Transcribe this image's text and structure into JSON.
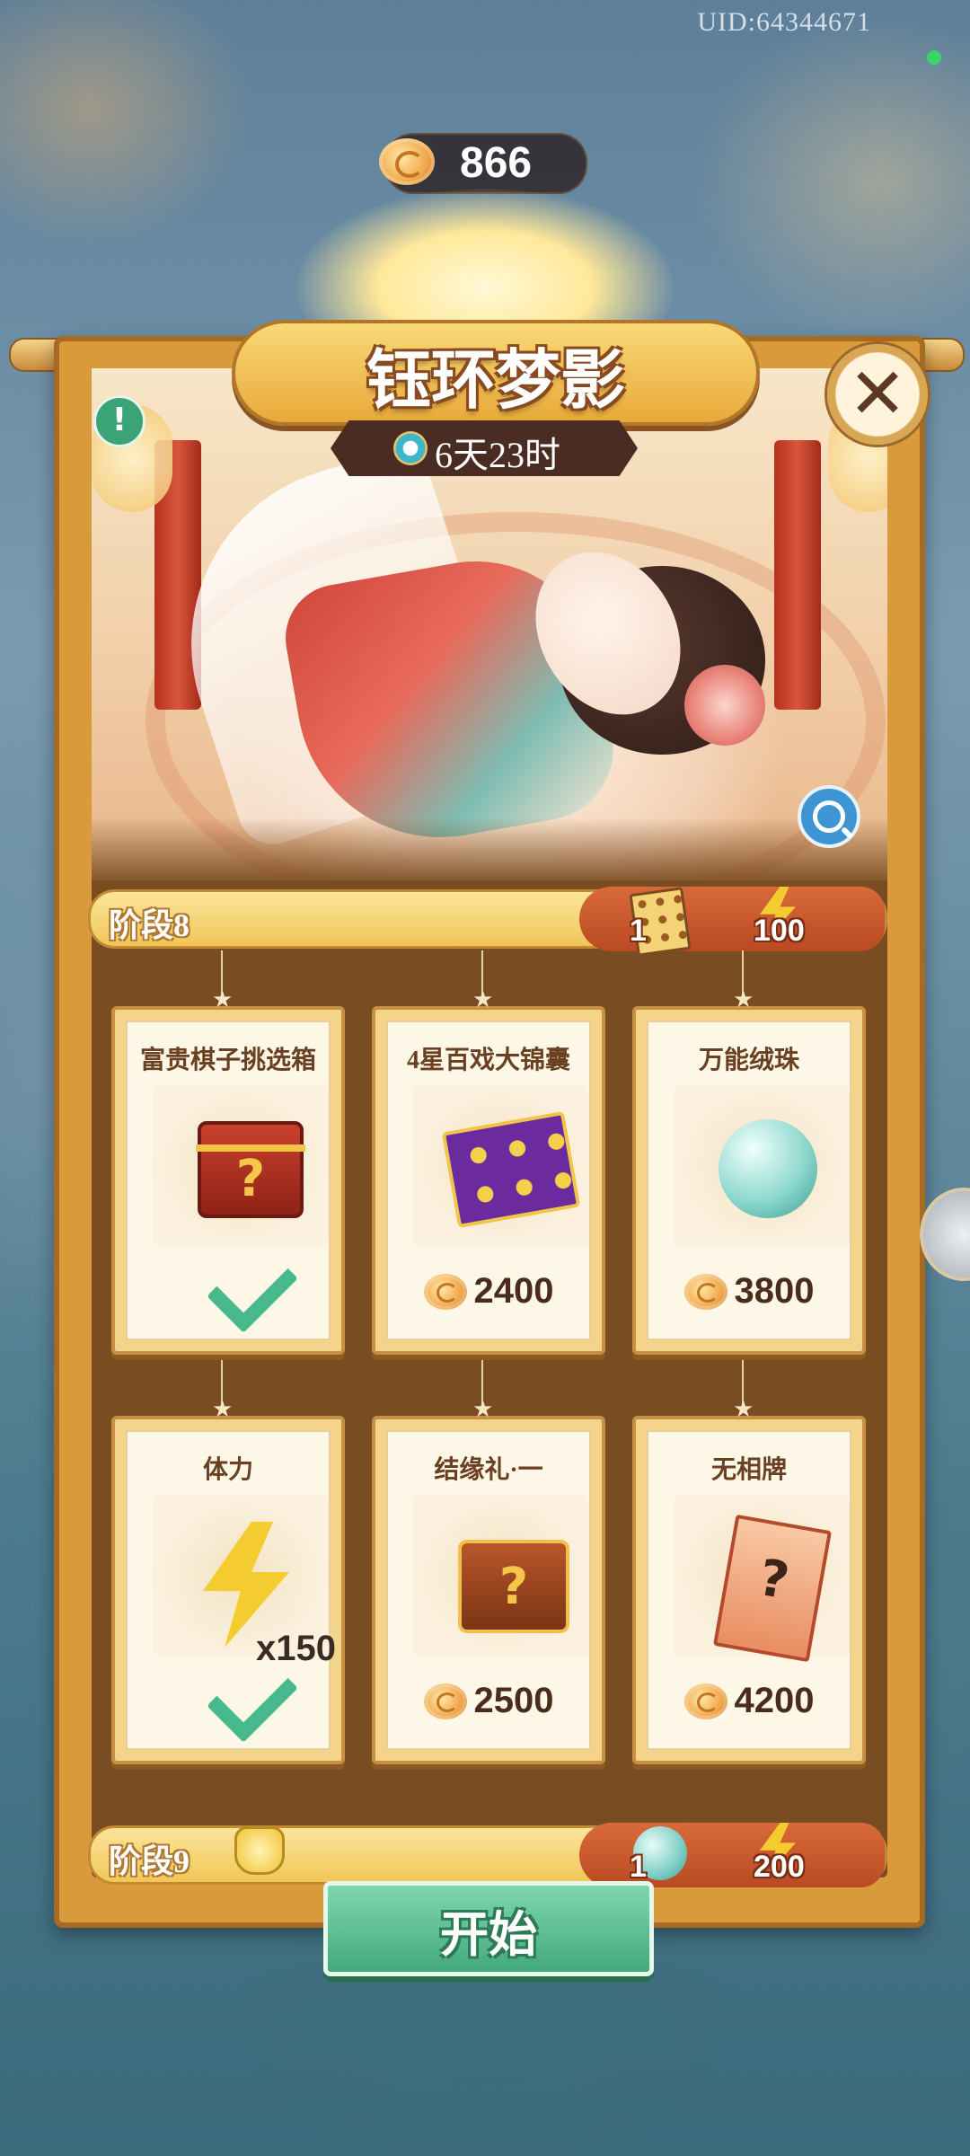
{
  "status": {
    "uid": "UID:64344671"
  },
  "currency": {
    "icon": "cloud-coin-icon",
    "amount": "866"
  },
  "event": {
    "title": "钰环梦影",
    "timer": "6天23时",
    "close_icon": "close-icon",
    "info_icon": "info-icon",
    "zoom_icon": "magnifier-icon"
  },
  "stages": [
    {
      "label": "阶段8",
      "rewards": [
        {
          "icon": "card-pack-icon",
          "count": "1"
        },
        {
          "icon": "lightning-icon",
          "count": "100"
        }
      ]
    },
    {
      "label": "阶段9",
      "icon": "gold-purse-icon",
      "rewards": [
        {
          "icon": "jade-orb-icon",
          "count": "1"
        },
        {
          "icon": "lightning-icon",
          "count": "200"
        }
      ]
    }
  ],
  "items": [
    {
      "name": "富贵棋子挑选箱",
      "icon": "mystery-chest-icon",
      "status": "claimed"
    },
    {
      "name": "4星百戏大锦囊",
      "icon": "card-pouch-icon",
      "price": "2400"
    },
    {
      "name": "万能绒珠",
      "icon": "cloud-orb-icon",
      "price": "3800"
    },
    {
      "name": "体力",
      "icon": "lightning-icon",
      "quantity": "x150",
      "status": "claimed"
    },
    {
      "name": "结缘礼·一",
      "icon": "gift-chest-icon",
      "price": "2500"
    },
    {
      "name": "无相牌",
      "icon": "mystery-card-icon",
      "price": "4200"
    }
  ],
  "start_button": {
    "label": "开始"
  },
  "colors": {
    "accent": "#f1c658",
    "button": "#43a97d",
    "panel": "#7a4c22"
  }
}
